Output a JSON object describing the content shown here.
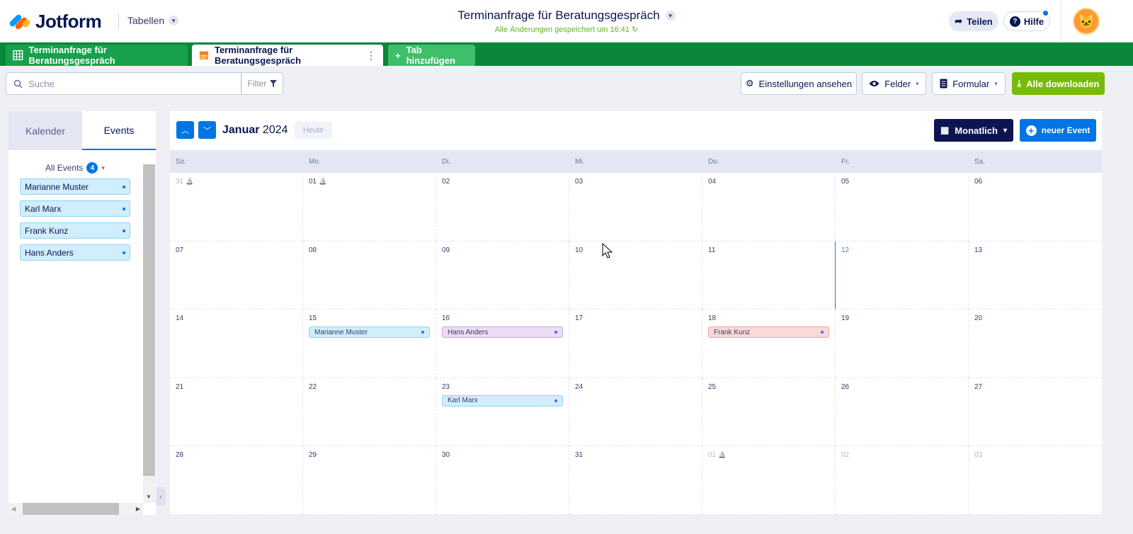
{
  "header": {
    "logo_text": "Jotform",
    "tables_menu": "Tabellen",
    "form_title": "Terminanfrage für Beratungsgespräch",
    "saved_status": "Alle Änderungen gespeichert um 16:41",
    "share_label": "Teilen",
    "help_label": "Hilfe"
  },
  "tabs": {
    "tab1": "Terminanfrage für Beratungsgespräch",
    "tab2": "Terminanfrage für Beratungsgespräch",
    "add_tab": "Tab hinzufügen"
  },
  "toolbar": {
    "search_placeholder": "Suche",
    "filter_label": "Filter",
    "settings_label": "Einstellungen ansehen",
    "fields_label": "Felder",
    "form_label": "Formular",
    "download_label": "Alle downloaden"
  },
  "sidebar": {
    "tab_calendar": "Kalender",
    "tab_events": "Events",
    "all_events_label": "All Events",
    "all_events_count": "4",
    "events": [
      "Marianne Muster",
      "Karl Marx",
      "Frank Kunz",
      "Hans Anders"
    ]
  },
  "calendar": {
    "month": "Januar",
    "year": "2024",
    "today_label": "Heute",
    "view_label": "Monatlich",
    "new_event_label": "neuer Event",
    "weekdays": [
      "So.",
      "Mo.",
      "Di.",
      "Mi.",
      "Do.",
      "Fr.",
      "Sa."
    ],
    "days": [
      {
        "label": "31",
        "muted": true,
        "bell": true
      },
      {
        "label": "01",
        "bell": true
      },
      {
        "label": "02"
      },
      {
        "label": "03"
      },
      {
        "label": "04"
      },
      {
        "label": "05"
      },
      {
        "label": "06"
      },
      {
        "label": "07"
      },
      {
        "label": "08"
      },
      {
        "label": "09"
      },
      {
        "label": "10"
      },
      {
        "label": "11"
      },
      {
        "label": "12",
        "today": true
      },
      {
        "label": "13"
      },
      {
        "label": "14"
      },
      {
        "label": "15",
        "event": "Marianne Muster",
        "color": "blue"
      },
      {
        "label": "16",
        "event": "Hans Anders",
        "color": "purple"
      },
      {
        "label": "17"
      },
      {
        "label": "18",
        "event": "Frank Kunz",
        "color": "red"
      },
      {
        "label": "19"
      },
      {
        "label": "20"
      },
      {
        "label": "21"
      },
      {
        "label": "22"
      },
      {
        "label": "23",
        "event": "Karl Marx",
        "color": "blue"
      },
      {
        "label": "24"
      },
      {
        "label": "25"
      },
      {
        "label": "26"
      },
      {
        "label": "27"
      },
      {
        "label": "28"
      },
      {
        "label": "29"
      },
      {
        "label": "30"
      },
      {
        "label": "31"
      },
      {
        "label": "01",
        "muted": true,
        "bell": true
      },
      {
        "label": "02",
        "muted": true
      },
      {
        "label": "03",
        "muted": true
      }
    ]
  }
}
